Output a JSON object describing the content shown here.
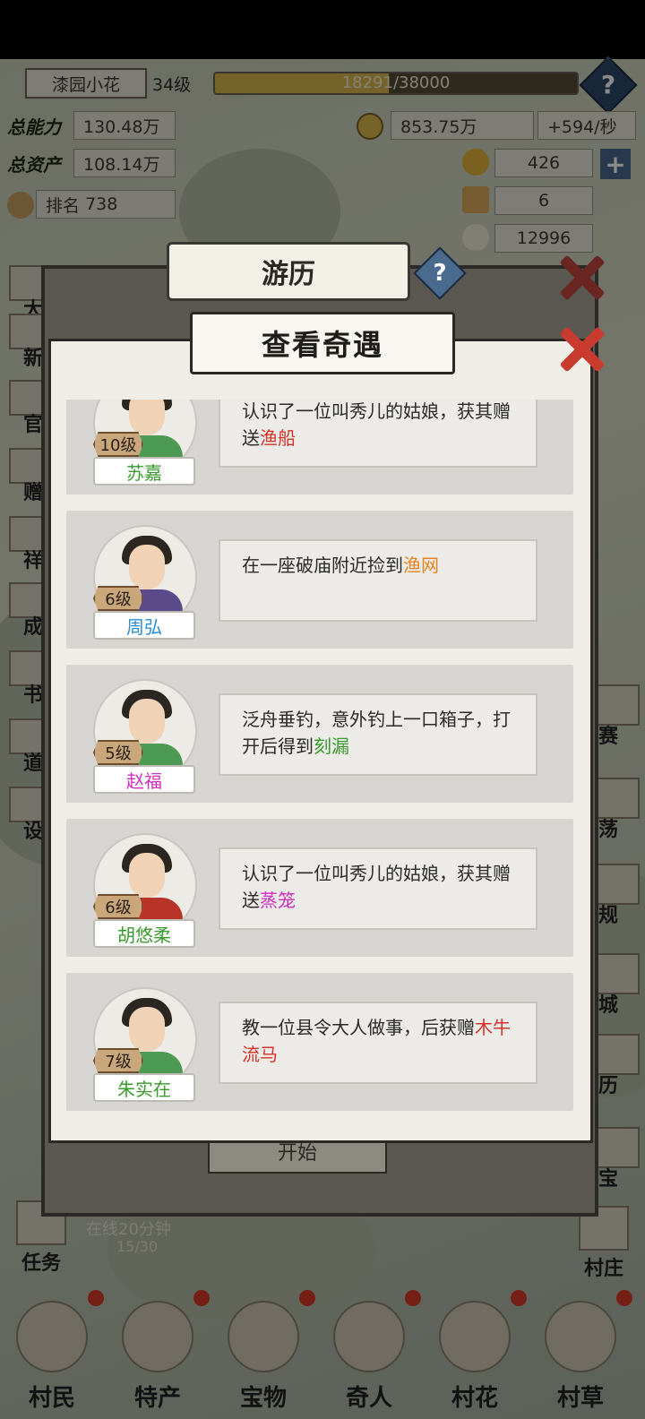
{
  "player": {
    "name": "漆园小花",
    "level": "34级",
    "exp_text": "18291/38000",
    "exp_progress": 0.48
  },
  "stats": {
    "total_power_label": "总能力",
    "total_power": "130.48万",
    "total_assets_label": "总资产",
    "total_assets": "108.14万",
    "rank_label": "排名",
    "rank": "738",
    "coins": "853.75万",
    "coin_rate": "+594/秒",
    "gold": "426",
    "tickets": "6",
    "rice": "12996",
    "plus_label": "+"
  },
  "help_label": "?",
  "back_dialog": {
    "title": "游历",
    "start_label": "开始"
  },
  "front_dialog": {
    "title": "查看奇遇"
  },
  "encounters": [
    {
      "level": "10级",
      "name": "苏嘉",
      "name_color": "#3a9a2e",
      "text": "认识了一位叫秀儿的姑娘，获其赠送",
      "item": "渔船",
      "item_color": "#d8322a",
      "outfit": "#4c9a54"
    },
    {
      "level": "6级",
      "name": "周弘",
      "name_color": "#2b8fd6",
      "text": "在一座破庙附近捡到",
      "item": "渔网",
      "item_color": "#e8821e",
      "outfit": "#5b4a8a"
    },
    {
      "level": "5级",
      "name": "赵福",
      "name_color": "#d22fc0",
      "text": "泛舟垂钓，意外钓上一口箱子，打开后得到",
      "item": "刻漏",
      "item_color": "#3a9a2e",
      "outfit": "#4c9a54"
    },
    {
      "level": "6级",
      "name": "胡悠柔",
      "name_color": "#3a9a2e",
      "text": "认识了一位叫秀儿的姑娘，获其赠送",
      "item": "蒸笼",
      "item_color": "#d22fc0",
      "outfit": "#b83428"
    },
    {
      "level": "7级",
      "name": "朱实在",
      "name_color": "#3a9a2e",
      "text": "教一位县令大人做事，后获赠",
      "item": "木牛流马",
      "item_color": "#d8322a",
      "outfit": "#4c9a54"
    }
  ],
  "left_side": [
    "大",
    "新",
    "官",
    "赠",
    "祥",
    "成",
    "书",
    "道",
    "设"
  ],
  "right_side": [
    "赛",
    "荡",
    "规",
    "城",
    "历",
    "宝"
  ],
  "task_label": "任务",
  "village_label": "村庄",
  "online_text": "在线20分钟",
  "online_sub": "15/30",
  "bottom_nav": [
    "村民",
    "特产",
    "宝物",
    "奇人",
    "村花",
    "村草"
  ],
  "colors": {
    "accent_red": "#c93a2f",
    "dialog_bg": "#efede6",
    "card_bg": "#d6d5d2"
  }
}
